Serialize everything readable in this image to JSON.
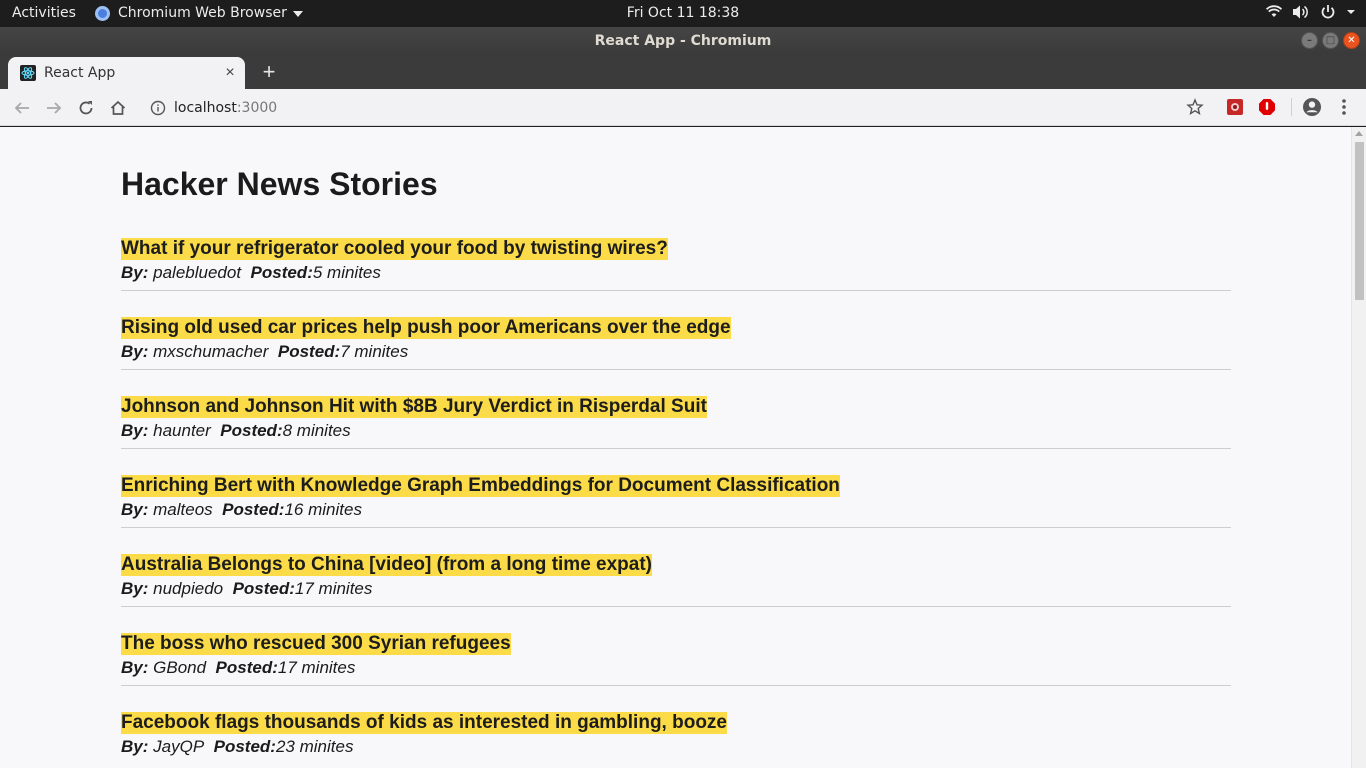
{
  "system": {
    "activities": "Activities",
    "app_name": "Chromium Web Browser",
    "clock": "Fri Oct 11  18:38"
  },
  "window": {
    "title": "React App - Chromium"
  },
  "tab": {
    "title": "React App",
    "close": "×",
    "new_tab": "+"
  },
  "address": {
    "host": "localhost",
    "port": ":3000"
  },
  "page": {
    "heading": "Hacker News Stories",
    "by_label": "By:",
    "posted_label": "Posted:",
    "stories": [
      {
        "title": "What if your refrigerator cooled your food by twisting wires?",
        "author": "palebluedot",
        "posted": "5 minites"
      },
      {
        "title": "Rising old used car prices help push poor Americans over the edge",
        "author": "mxschumacher",
        "posted": "7 minites"
      },
      {
        "title": "Johnson and Johnson Hit with $8B Jury Verdict in Risperdal Suit",
        "author": "haunter",
        "posted": "8 minites"
      },
      {
        "title": "Enriching Bert with Knowledge Graph Embeddings for Document Classification",
        "author": "malteos",
        "posted": "16 minites"
      },
      {
        "title": "Australia Belongs to China [video] (from a long time expat)",
        "author": "nudpiedo",
        "posted": "17 minites"
      },
      {
        "title": "The boss who rescued 300 Syrian refugees",
        "author": "GBond",
        "posted": "17 minites"
      },
      {
        "title": "Facebook flags thousands of kids as interested in gambling, booze",
        "author": "JayQP",
        "posted": "23 minites"
      }
    ]
  },
  "colors": {
    "highlight": "#fbdb47",
    "ubuntu_orange": "#e95420"
  }
}
